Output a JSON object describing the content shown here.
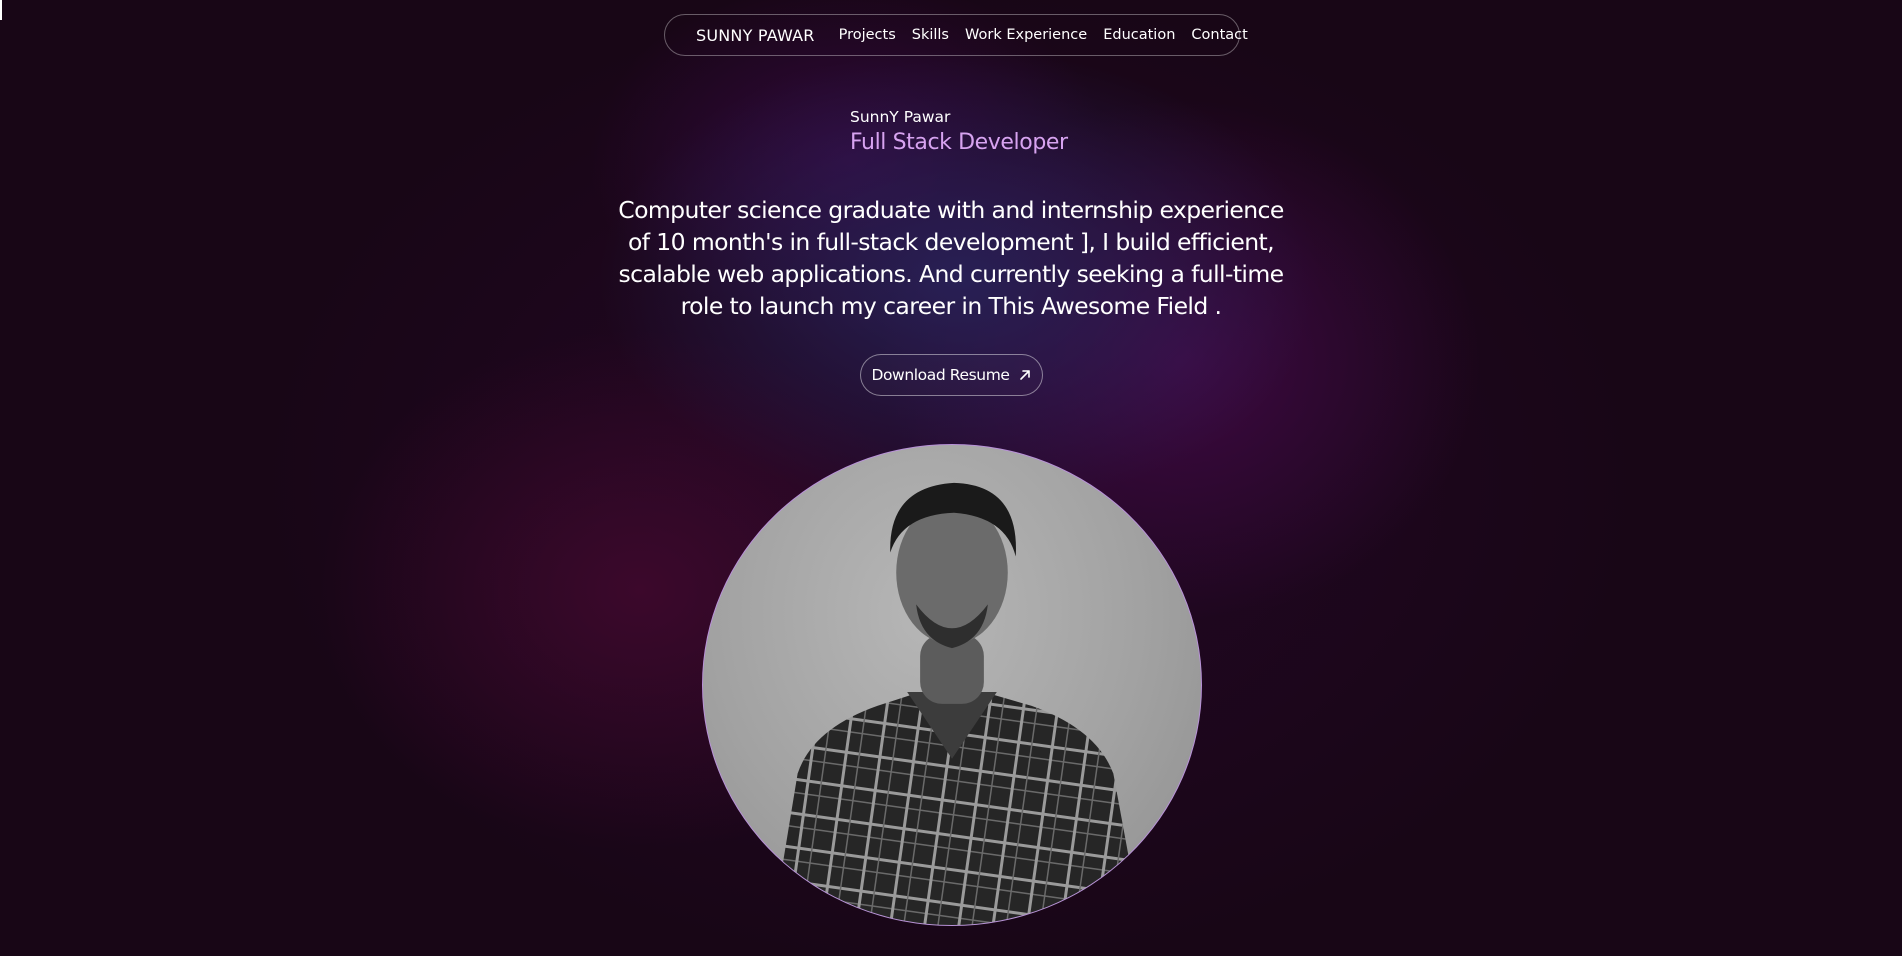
{
  "nav": {
    "brand": "SUNNY PAWAR",
    "links": [
      "Projects",
      "Skills",
      "Work Experience",
      "Education",
      "Contact"
    ]
  },
  "hero": {
    "name": "SunnY Pawar",
    "role": "Full Stack Developer",
    "summary": "Computer science graduate with and internship experience of 10 month's in full-stack development ], I build efficient, scalable web applications. And currently seeking a full-time role to launch my career in This Awesome Field .",
    "resume_button": "Download Resume"
  },
  "icons": {
    "resume_arrow": "arrow-up-right-icon"
  },
  "colors": {
    "background": "#180616",
    "role_accent": "#d7a3f0",
    "portrait_border": "#b892d8"
  }
}
